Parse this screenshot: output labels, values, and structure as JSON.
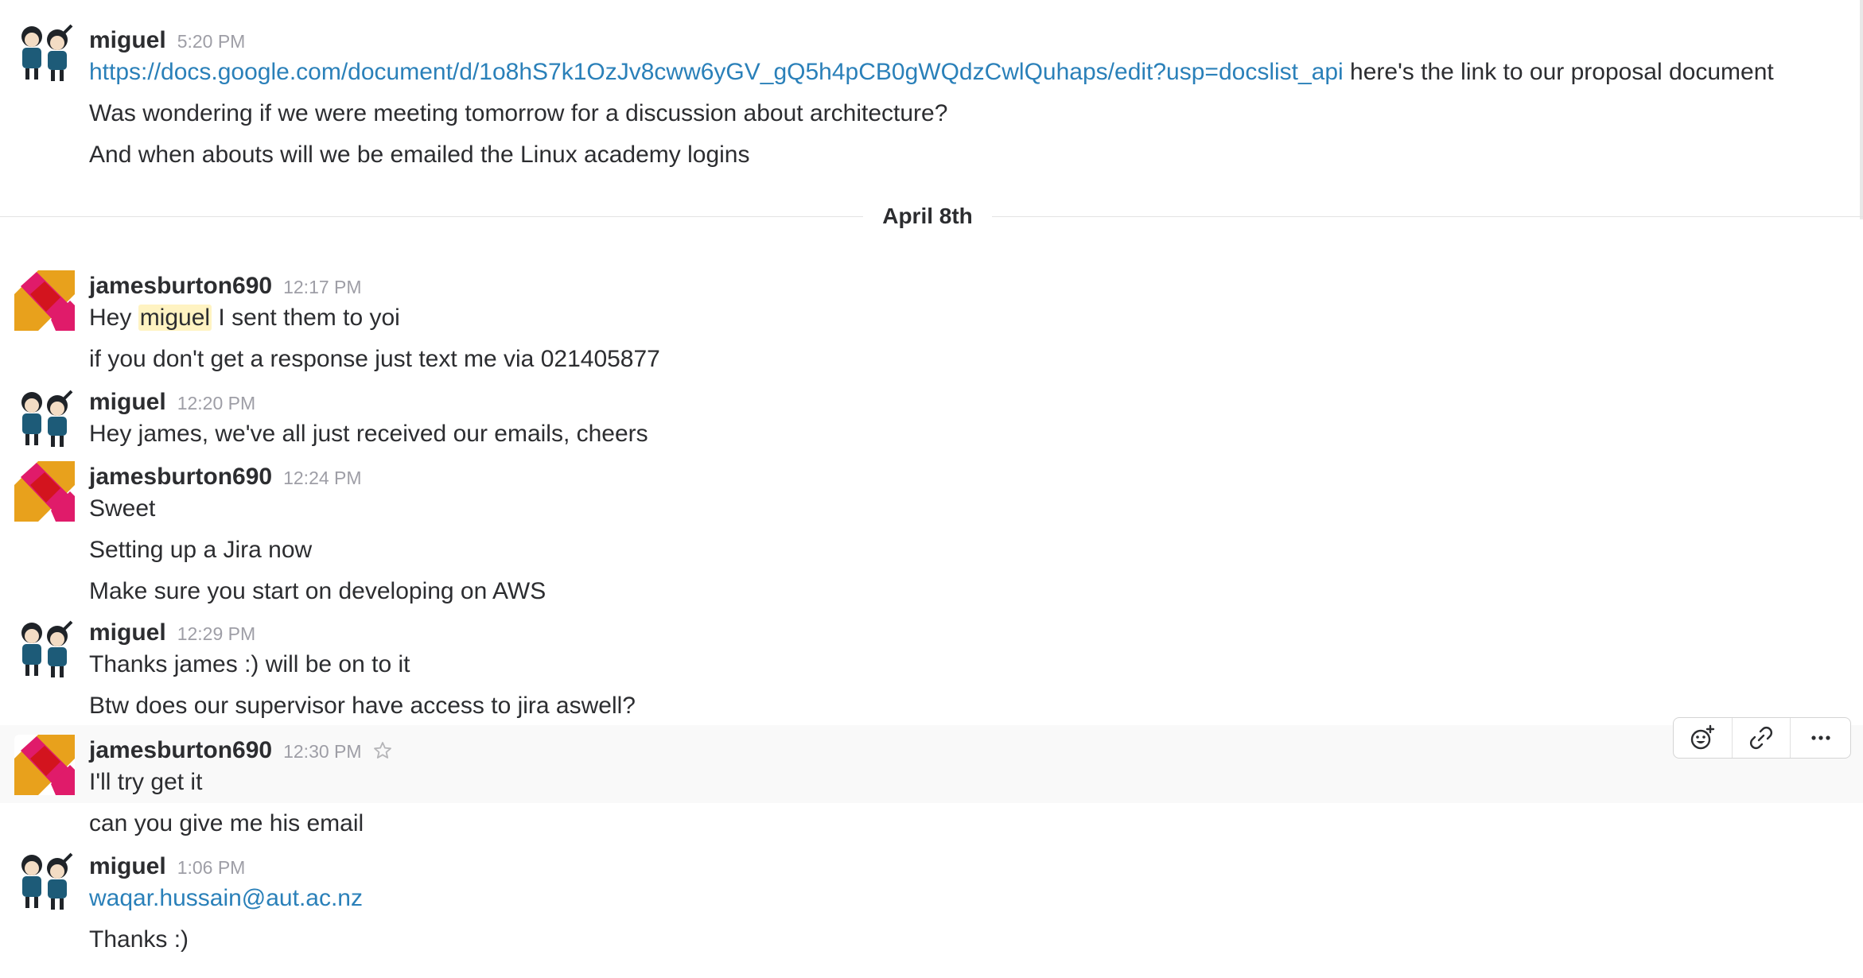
{
  "divider": {
    "date": "April 8th"
  },
  "users": {
    "miguel": "miguel",
    "james": "jamesburton690"
  },
  "groups": [
    {
      "user": "miguel",
      "time": "5:20 PM",
      "lines": [
        {
          "link": "https://docs.google.com/document/d/1o8hS7k1OzJv8cww6yGV_gQ5h4pCB0gWQdzCwlQuhaps/edit?usp=docslist_api",
          "text": " here's the link to our proposal document"
        },
        {
          "text": "Was wondering if we were meeting tomorrow for a discussion about architecture?"
        },
        {
          "text": "And when abouts will we be emailed the Linux academy logins"
        }
      ]
    },
    {
      "user": "jamesburton690",
      "time": "12:17 PM",
      "lines": [
        {
          "pre": "Hey ",
          "mention": "miguel",
          "post": " I sent them to yoi"
        },
        {
          "text": "if you don't get a response just text me via 021405877"
        }
      ]
    },
    {
      "user": "miguel",
      "time": "12:20 PM",
      "lines": [
        {
          "text": "Hey james, we've all just received our emails, cheers"
        }
      ]
    },
    {
      "user": "jamesburton690",
      "time": "12:24 PM",
      "lines": [
        {
          "text": "Sweet"
        },
        {
          "text": "Setting up a Jira now"
        },
        {
          "text": "Make sure you start on developing on AWS"
        }
      ]
    },
    {
      "user": "miguel",
      "time": "12:29 PM",
      "lines": [
        {
          "text": "Thanks james :) will be on to it"
        },
        {
          "text": "Btw does our supervisor have access to jira aswell?"
        }
      ]
    },
    {
      "user": "jamesburton690",
      "time": "12:30 PM",
      "lines": [
        {
          "text": "I'll try get it"
        },
        {
          "text": "can you give me his email"
        }
      ]
    },
    {
      "user": "miguel",
      "time": "1:06 PM",
      "lines": [
        {
          "link": "waqar.hussain@aut.ac.nz"
        },
        {
          "text": "Thanks :)"
        }
      ]
    }
  ],
  "icons": {
    "star": "star-outline-icon",
    "reaction": "add-reaction-icon",
    "link": "copy-link-icon",
    "more": "more-actions-icon"
  },
  "colors": {
    "link": "#2a80b9",
    "mention_bg": "#fff3c2",
    "hover_bg": "#f9f9f9",
    "timestamp": "#9e9ea6"
  }
}
